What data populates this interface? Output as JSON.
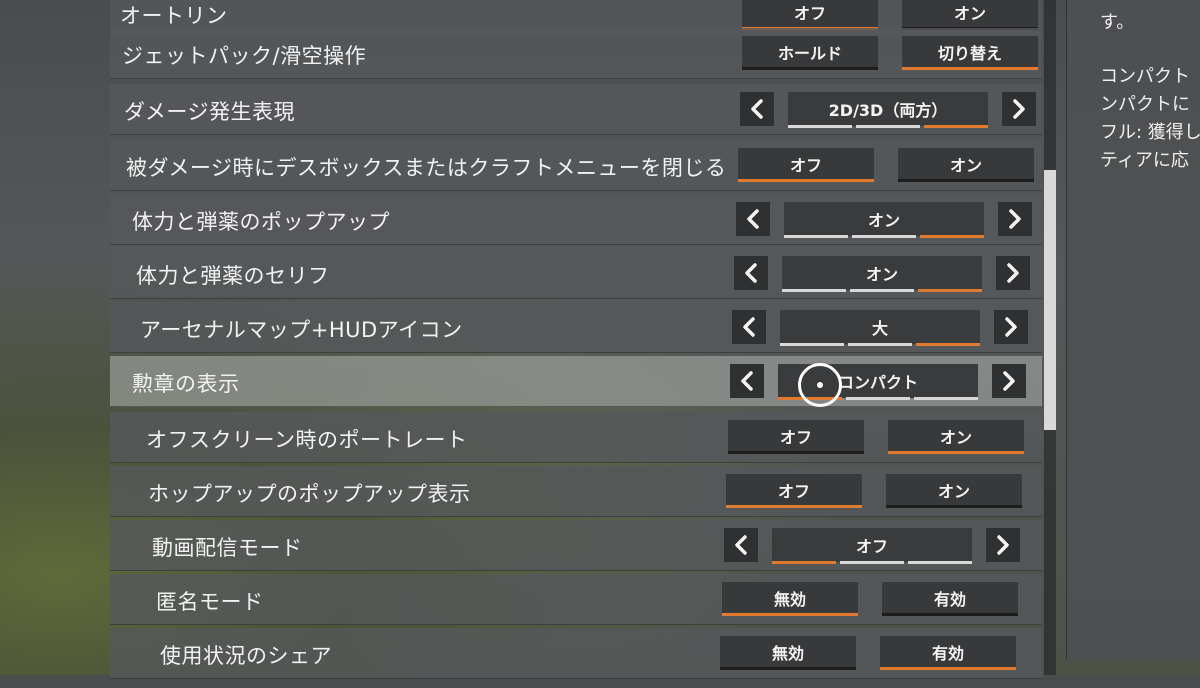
{
  "rows": [
    {
      "label": "オートリン",
      "type": "toggle",
      "options": [
        "オフ",
        "オン"
      ],
      "selected": 0
    },
    {
      "label": "ジェットパック/滑空操作",
      "type": "toggle",
      "options": [
        "ホールド",
        "切り替え"
      ],
      "selected": 1
    },
    {
      "label": "ダメージ発生表現",
      "type": "cycle",
      "value": "2D/3D（両方）",
      "segments": 3,
      "active_segment": 2
    },
    {
      "label": "被ダメージ時にデスボックスまたはクラフトメニューを閉じる",
      "type": "toggle",
      "options": [
        "オフ",
        "オン"
      ],
      "selected": 0
    },
    {
      "label": "体力と弾薬のポップアップ",
      "type": "cycle",
      "value": "オン",
      "segments": 3,
      "active_segment": 2
    },
    {
      "label": "体力と弾薬のセリフ",
      "type": "cycle",
      "value": "オン",
      "segments": 3,
      "active_segment": 2
    },
    {
      "label": "アーセナルマップ+HUDアイコン",
      "type": "cycle",
      "value": "大",
      "segments": 3,
      "active_segment": 2
    },
    {
      "label": "勲章の表示",
      "type": "cycle",
      "value": "コンパクト",
      "segments": 3,
      "active_segment": 0
    },
    {
      "label": "オフスクリーン時のポートレート",
      "type": "toggle",
      "options": [
        "オフ",
        "オン"
      ],
      "selected": 1
    },
    {
      "label": "ホップアップのポップアップ表示",
      "type": "toggle",
      "options": [
        "オフ",
        "オン"
      ],
      "selected": 0
    },
    {
      "label": "動画配信モード",
      "type": "cycle",
      "value": "オフ",
      "segments": 3,
      "active_segment": 0
    },
    {
      "label": "匿名モード",
      "type": "toggle",
      "options": [
        "無効",
        "有効"
      ],
      "selected": 0
    },
    {
      "label": "使用状況のシェア",
      "type": "toggle",
      "options": [
        "無効",
        "有効"
      ],
      "selected": 1
    }
  ],
  "arrows": {
    "left": "chevron-left-icon",
    "right": "chevron-right-icon"
  },
  "description_panel": {
    "lines": [
      "す。",
      "",
      "コンパクト",
      "ンパクトに",
      "フル: 獲得し",
      "ティアに応"
    ]
  },
  "colors": {
    "accent": "#e07a2e",
    "row_bg": "#55585a",
    "button_bg": "#38393b"
  }
}
